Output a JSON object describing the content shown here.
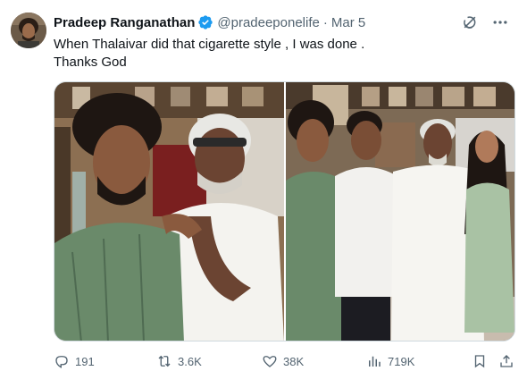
{
  "tweet": {
    "author_name": "Pradeep Ranganathan",
    "author_handle": "@pradeeponelife",
    "separator": "·",
    "date": "Mar 5",
    "text_lines": [
      "When Thalaivar did that cigarette style , I was done .",
      "Thanks God"
    ],
    "verified": true
  },
  "actions": {
    "replies": "191",
    "reposts": "3.6K",
    "likes": "38K",
    "views": "719K"
  },
  "icons": {
    "verified": "verified-badge-icon",
    "grok": "grok-icon",
    "more": "more-icon",
    "reply": "reply-icon",
    "repost": "repost-icon",
    "like": "heart-icon",
    "views": "views-icon",
    "bookmark": "bookmark-icon",
    "share": "share-icon"
  },
  "colors": {
    "verified_blue": "#1d9bf0",
    "text_primary": "#0f1419",
    "text_secondary": "#536471"
  }
}
